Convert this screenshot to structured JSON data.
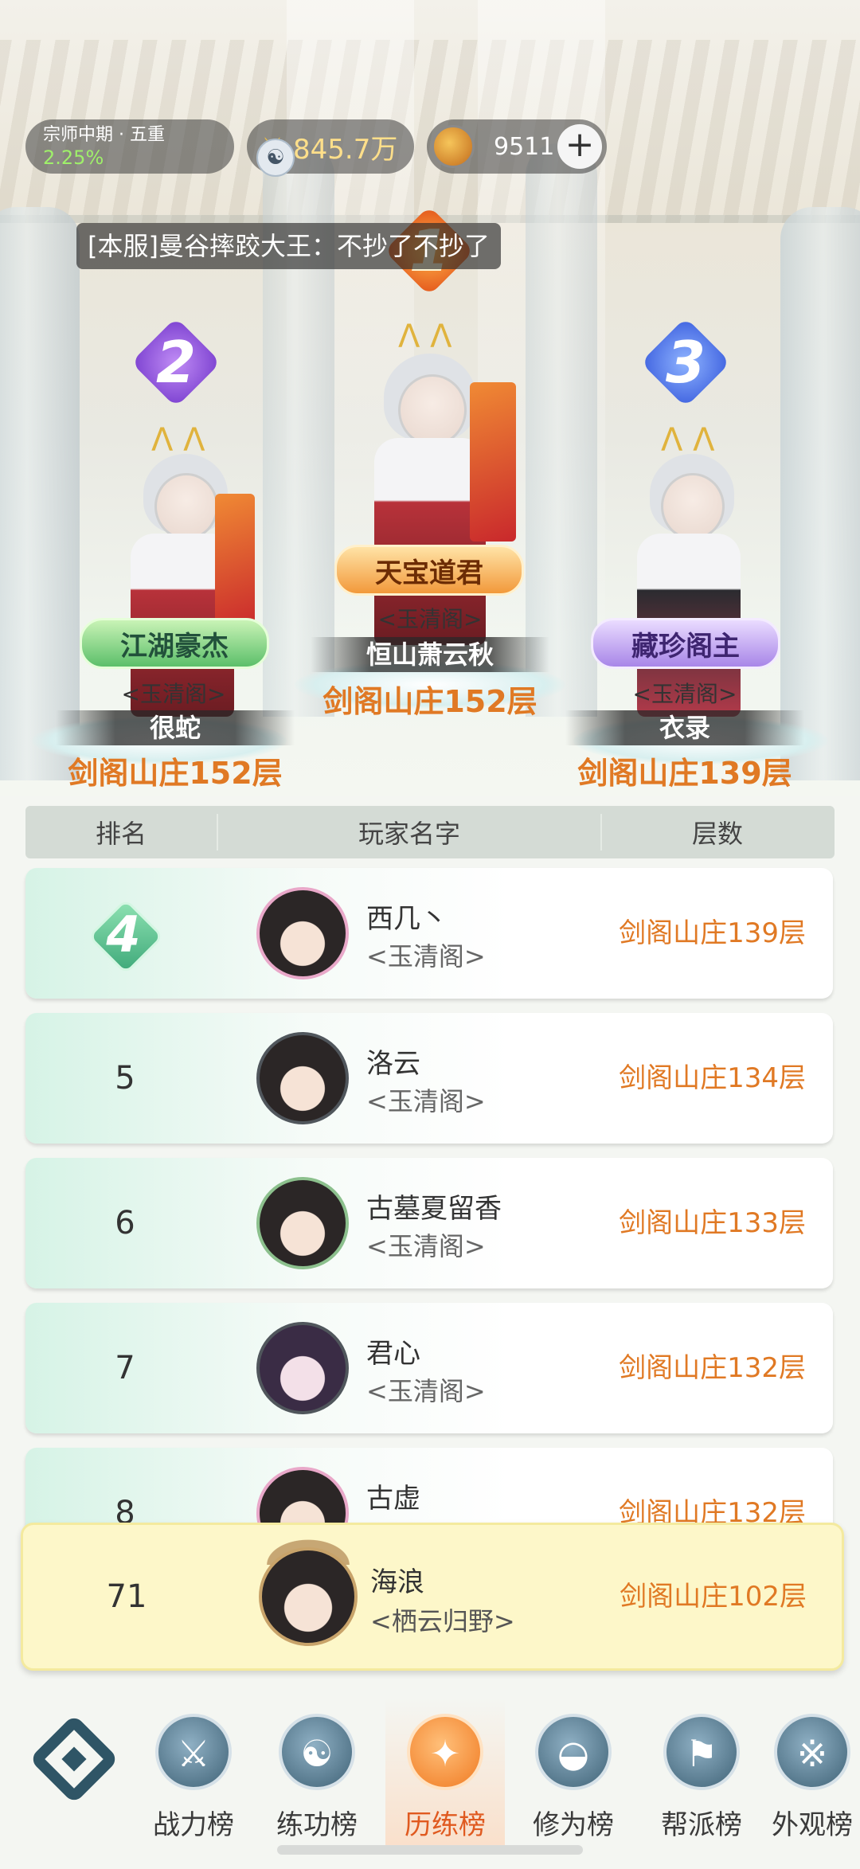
{
  "topbar": {
    "rank_title": "宗师中期 · 五重",
    "rank_progress": "2.25%",
    "power": "845.7万",
    "coins": "9511",
    "add_label": "+"
  },
  "chat_message": "[本服]曼谷摔跤大王：不抄了不抄了",
  "podium": {
    "first": {
      "rank": "1",
      "title": "天宝道君",
      "guild": "<玉清阁>",
      "name": "恒山萧云秋",
      "floor": "剑阁山庄152层"
    },
    "second": {
      "rank": "2",
      "title": "江湖豪杰",
      "guild": "<玉清阁>",
      "name": "很蛇",
      "floor": "剑阁山庄152层"
    },
    "third": {
      "rank": "3",
      "title": "藏珍阁主",
      "guild": "<玉清阁>",
      "name": "衣录",
      "floor": "剑阁山庄139层"
    }
  },
  "table": {
    "headers": [
      "排名",
      "玩家名字",
      "层数"
    ],
    "rows": [
      {
        "rank": "4",
        "name": "西几丶",
        "guild": "<玉清阁>",
        "floor": "剑阁山庄139层"
      },
      {
        "rank": "5",
        "name": "洛云",
        "guild": "<玉清阁>",
        "floor": "剑阁山庄134层"
      },
      {
        "rank": "6",
        "name": "古墓夏留香",
        "guild": "<玉清阁>",
        "floor": "剑阁山庄133层"
      },
      {
        "rank": "7",
        "name": "君心",
        "guild": "<玉清阁>",
        "floor": "剑阁山庄132层"
      },
      {
        "rank": "8",
        "name": "古虚",
        "guild": "",
        "floor": "剑阁山庄132层"
      }
    ]
  },
  "self_row": {
    "rank": "71",
    "name": "海浪",
    "guild": "<栖云归野>",
    "floor": "剑阁山庄102层"
  },
  "nav": {
    "tabs": [
      "战力榜",
      "练功榜",
      "历练榜",
      "修为榜",
      "帮派榜",
      "外观榜"
    ],
    "active_tab": "历练榜"
  },
  "colors": {
    "accent_orange": "#e07924",
    "self_row_bg": "#fdf7c9"
  }
}
